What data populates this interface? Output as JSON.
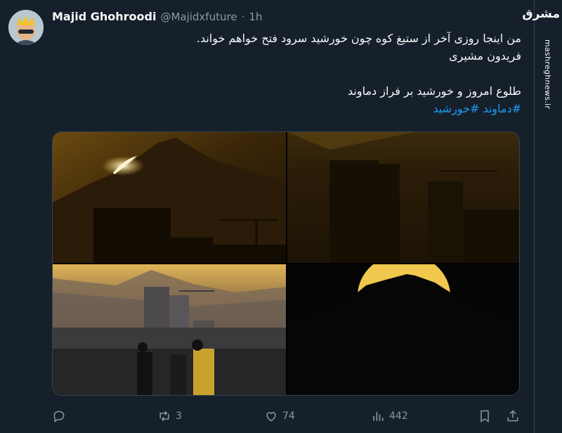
{
  "tweet": {
    "author_name": "Majid Ghohroodi",
    "handle": "@Majidxfuture",
    "separator": "·",
    "time": "1h",
    "more_icon": "more-dots-icon",
    "lines": [
      "من اینجا روزی آخر از ستیغ کوه چون خورشید سرود فتح خواهم خواند.",
      "فریدون مشیری",
      "طلوع امروز و خورشید بر فراز دماوند"
    ],
    "hashtags": "#دماوند #خورشید",
    "media": [
      {
        "name": "photo-1",
        "alt_icon": "sunrise-over-mountain-photo"
      },
      {
        "name": "photo-2",
        "alt_icon": "dark-city-silhouette-photo"
      },
      {
        "name": "photo-3",
        "alt_icon": "city-skyline-people-photo"
      },
      {
        "name": "photo-4",
        "alt_icon": "sun-behind-damavand-photo"
      }
    ]
  },
  "actions": {
    "reply_icon": "reply-icon",
    "retweet_icon": "retweet-icon",
    "retweet_count": "3",
    "like_icon": "heart-icon",
    "like_count": "74",
    "views_icon": "views-chart-icon",
    "views_count": "442",
    "bookmark_icon": "bookmark-icon",
    "share_icon": "share-icon"
  },
  "watermark": {
    "logo_text": "مشرق",
    "site": "mashreghnews.ir"
  },
  "colors": {
    "background": "#15202b",
    "text": "#f7f9f9",
    "muted": "#8b98a5",
    "link": "#1d9bf0"
  }
}
